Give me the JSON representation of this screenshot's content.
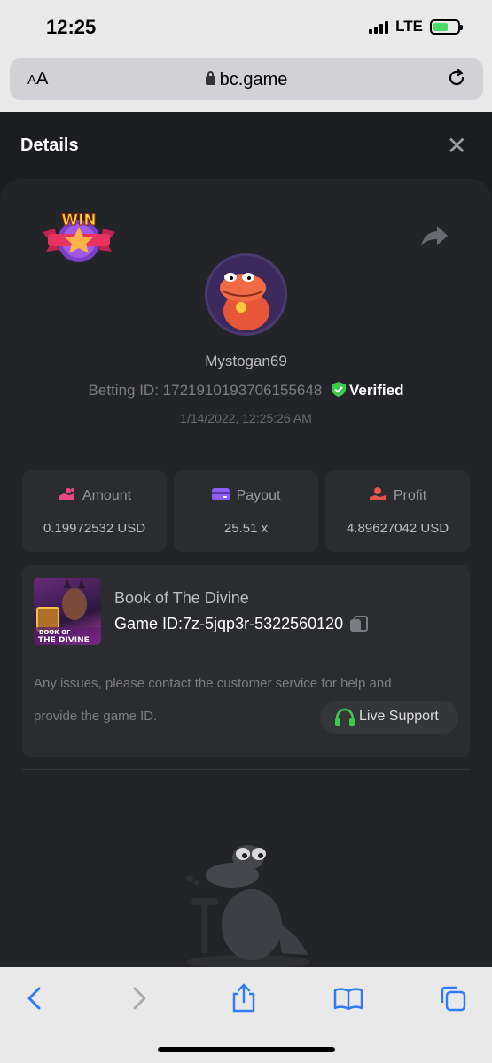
{
  "status_bar": {
    "time": "12:25",
    "network": "LTE",
    "battery_charging": true
  },
  "browser": {
    "text_size_label": "AA",
    "url": "bc.game"
  },
  "modal": {
    "title": "Details"
  },
  "bet": {
    "badge": "WIN",
    "username": "Mystogan69",
    "betting_id_label": "Betting ID:",
    "betting_id": "1721910193706155648",
    "verified_label": "Verified",
    "timestamp": "1/14/2022, 12:25:26 AM"
  },
  "stats": [
    {
      "label": "Amount",
      "value": "0.19972532 USD",
      "icon": "amount-icon"
    },
    {
      "label": "Payout",
      "value": "25.51 x",
      "icon": "payout-icon"
    },
    {
      "label": "Profit",
      "value": "4.89627042 USD",
      "icon": "profit-icon"
    }
  ],
  "game": {
    "thumb_text_1": "BOOK OF",
    "thumb_text_2": "THE DIVINE",
    "name": "Book of The Divine",
    "id_label": "Game ID:",
    "id": "7z-5jqp3r-5322560120",
    "help_line_1": "Any issues, please contact the customer service for help and",
    "help_line_2": "provide the game ID.",
    "live_support_label": "Live Support"
  },
  "colors": {
    "accent_green": "#3ec94a",
    "amount_pink": "#e84a7f",
    "payout_purple": "#8c5cf5",
    "profit_red": "#e8534a",
    "panel_bg": "#232427",
    "card_bg": "#2b2c30"
  }
}
